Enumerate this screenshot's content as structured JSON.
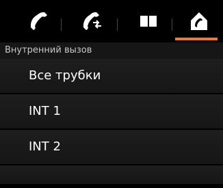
{
  "tabs": [
    {
      "icon": "handset-icon"
    },
    {
      "icon": "call-transfer-icon"
    },
    {
      "icon": "phonebook-icon"
    },
    {
      "icon": "internal-call-icon",
      "active": true
    }
  ],
  "accent_color": "#f07a33",
  "section": {
    "title": "Внутренний вызов"
  },
  "list": {
    "items": [
      {
        "label": "Все трубки"
      },
      {
        "label": "INT 1"
      },
      {
        "label": "INT 2"
      }
    ]
  }
}
